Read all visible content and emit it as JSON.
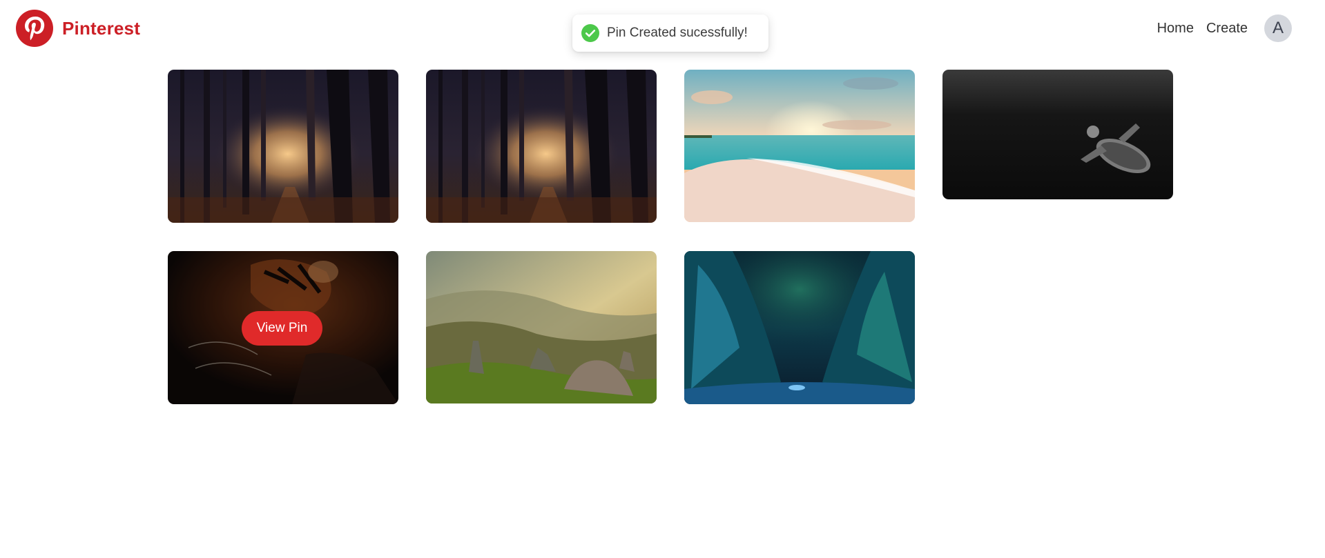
{
  "header": {
    "brand_name": "Pinterest",
    "brand_color": "#cc1f26",
    "logo_icon": "pinterest-logo-icon",
    "nav": {
      "home": "Home",
      "create": "Create"
    },
    "avatar_initial": "A"
  },
  "toast": {
    "message": "Pin Created sucessfully!",
    "icon": "check-circle-icon",
    "icon_color": "#4cc84a"
  },
  "pins": [
    {
      "image": "misty-forest-path"
    },
    {
      "image": "misty-forest-path"
    },
    {
      "image": "sunset-beach"
    },
    {
      "image": "sea-turtle-underwater-bw"
    },
    {
      "image": "tiger-closeup",
      "hover_button": "View Pin"
    },
    {
      "image": "mountain-valley-golden-light"
    },
    {
      "image": "aurora-ice-canyon"
    }
  ],
  "colors": {
    "view_pin_button": "#e02a2a"
  }
}
